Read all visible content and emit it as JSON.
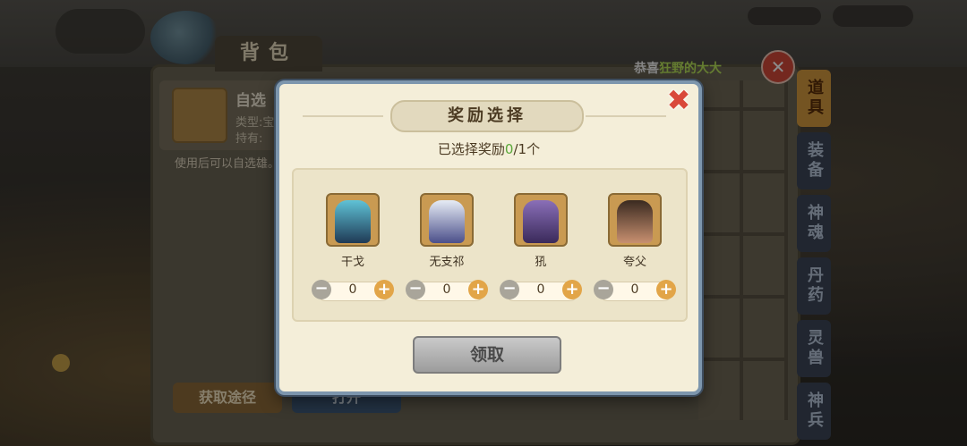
{
  "background": {
    "bag_title": "背包",
    "item": {
      "name": "自选",
      "type_label": "类型:宝",
      "owned_label": "持有:"
    },
    "item_desc": "使用后可以自选雄。",
    "get_path_label": "获取途径",
    "open_label": "打开",
    "marquee": {
      "prefix": "恭喜",
      "player": "狂野的大大"
    },
    "side_tabs": [
      {
        "label": "道具",
        "active": true
      },
      {
        "label": "装备",
        "active": false
      },
      {
        "label": "神魂",
        "active": false
      },
      {
        "label": "丹药",
        "active": false
      },
      {
        "label": "灵兽",
        "active": false
      },
      {
        "label": "神兵",
        "active": false
      }
    ]
  },
  "modal": {
    "title": "奖励选择",
    "selected_prefix": "已选择奖励",
    "selected_count": "0",
    "selected_total": "/1个",
    "claim_label": "领取",
    "rewards": [
      {
        "name": "干戈",
        "qty": "0",
        "icon": "armored-warrior-portrait"
      },
      {
        "name": "无支祁",
        "qty": "0",
        "icon": "white-ape-portrait"
      },
      {
        "name": "犼",
        "qty": "0",
        "icon": "wolf-beast-portrait"
      },
      {
        "name": "夸父",
        "qty": "0",
        "icon": "giant-hero-portrait"
      }
    ]
  },
  "colors": {
    "modal_bg": "#f4eed9",
    "modal_border": "#7d96ad",
    "count_highlight": "#5aa83a",
    "close_red": "#d9483a",
    "plus_orange": "#e2a548",
    "minus_grey": "#a9a59a"
  }
}
